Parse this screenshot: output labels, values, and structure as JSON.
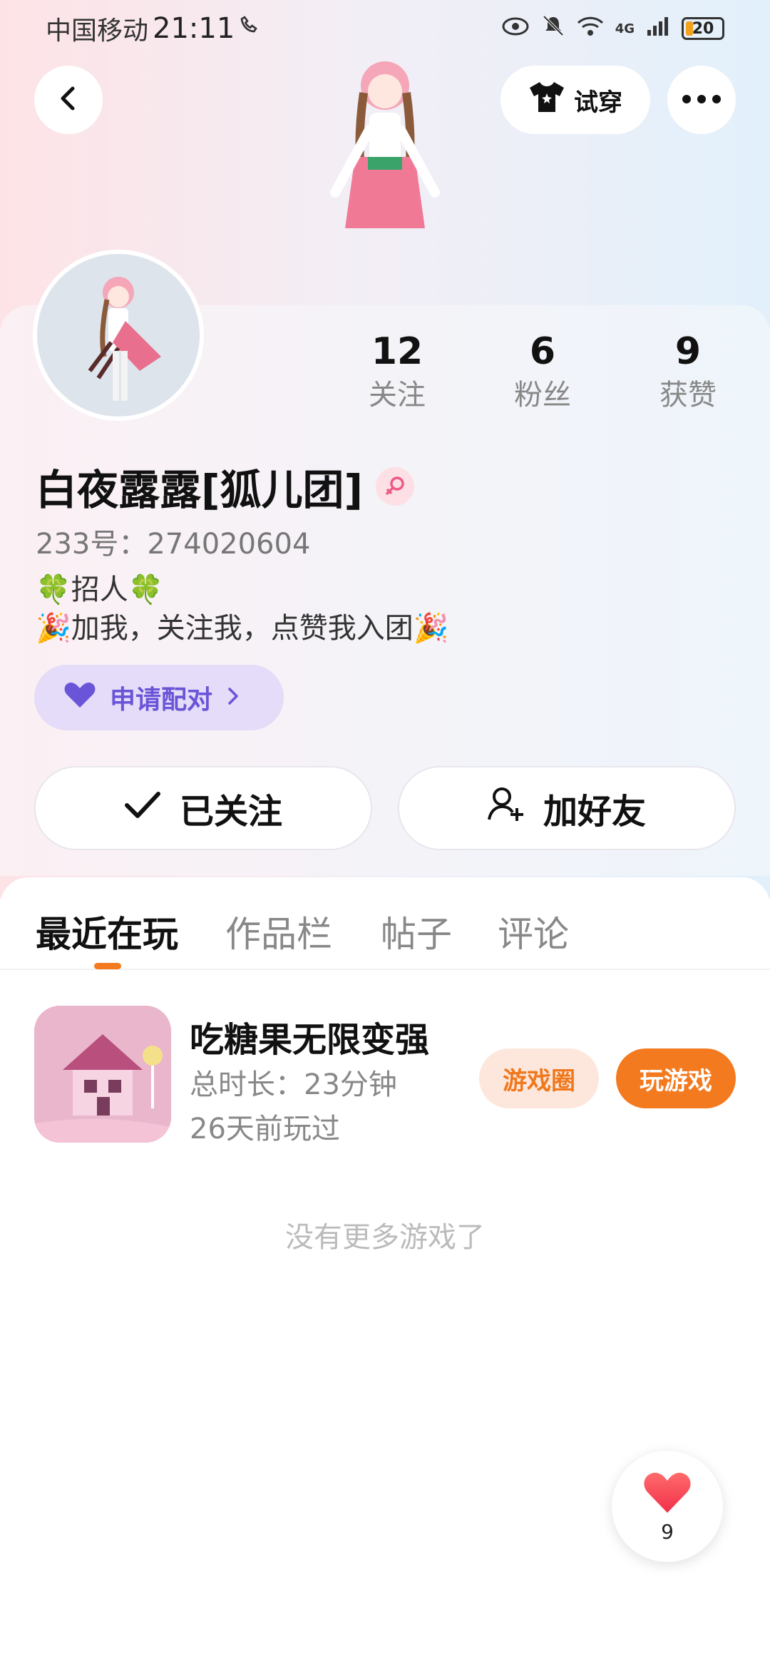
{
  "status_bar": {
    "carrier": "中国移动",
    "time": "21:11",
    "network": "4G",
    "battery": "20",
    "battery_level": 0.2
  },
  "header": {
    "back_icon": "chevron-left-icon",
    "tryon_label": "试穿",
    "tryon_icon": "tshirt-icon",
    "more_icon": "more-dots-icon"
  },
  "profile": {
    "name": "白夜露露[狐儿团]",
    "gender_icon": "female-icon",
    "uid": "233号：274020604",
    "bio_line1": "🍀招人🍀",
    "bio_line2": "🎉加我，关注我，点赞我入团🎉",
    "pair_label": "申请配对",
    "stats": [
      {
        "value": "12",
        "label": "关注"
      },
      {
        "value": "6",
        "label": "粉丝"
      },
      {
        "value": "9",
        "label": "获赞"
      }
    ]
  },
  "actions": {
    "followed_label": "已关注",
    "add_friend_label": "加好友"
  },
  "tabs": [
    {
      "label": "最近在玩",
      "active": true
    },
    {
      "label": "作品栏",
      "active": false
    },
    {
      "label": "帖子",
      "active": false
    },
    {
      "label": "评论",
      "active": false
    }
  ],
  "games": [
    {
      "title": "吃糖果无限变强",
      "duration": "总时长：23分钟",
      "last_played": "26天前玩过",
      "circle_label": "游戏圈",
      "play_label": "玩游戏"
    }
  ],
  "no_more": "没有更多游戏了",
  "like_fab": {
    "count": "9",
    "icon": "heart-icon"
  },
  "colors": {
    "accent_orange": "#f47a1f",
    "pair_purple": "#6a55d8",
    "pair_bg": "#e4dcf8"
  }
}
